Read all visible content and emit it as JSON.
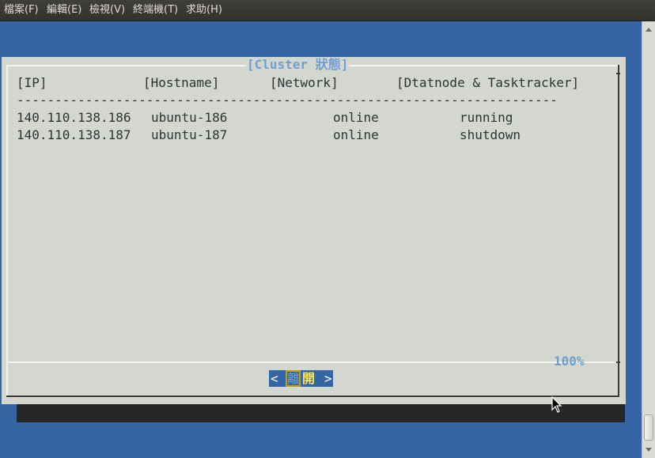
{
  "menubar": {
    "items": [
      "檔案(F)",
      "編輯(E)",
      "檢視(V)",
      "終端機(T)",
      "求助(H)"
    ]
  },
  "dialog": {
    "title": "[Cluster 狀態]",
    "headers": [
      "[IP]",
      "[Hostname]",
      "[Network]",
      "[Dtatnode & Tasktracker]"
    ],
    "separator": "-----------------------------------------------------------------------",
    "rows": [
      {
        "ip": "140.110.138.186",
        "hostname": "ubuntu-186",
        "network": "online",
        "status": "running"
      },
      {
        "ip": "140.110.138.187",
        "hostname": "ubuntu-187",
        "network": "online",
        "status": "shutdown"
      }
    ],
    "percent": "100%",
    "button": {
      "left": "<",
      "hotkey": "離",
      "rest": "開",
      "right": ">"
    }
  },
  "colors": {
    "terminal_bg": "#3465a4",
    "dialog_bg": "#d3d7cf",
    "title": "#729fcf",
    "button_bg": "#3465a4",
    "button_text": "#fce94f"
  }
}
